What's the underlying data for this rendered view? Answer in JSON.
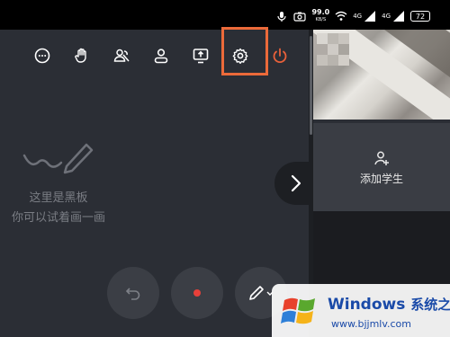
{
  "status_bar": {
    "net_speed_value": "99.0",
    "net_speed_unit": "KB/S",
    "signal1_label": "4G",
    "signal2_label": "4G",
    "battery_level": "72"
  },
  "blackboard": {
    "line1": "这里是黑板",
    "line2": "你可以试着画一画"
  },
  "student_panel": {
    "add_student_label": "添加学生"
  },
  "watermark": {
    "title_en": "Windows",
    "title_cn": "系统之家",
    "url": "www.bjjmlv.com"
  },
  "colors": {
    "highlight": "#ec6a3a",
    "power": "#e8603a",
    "record": "#e8403a"
  }
}
